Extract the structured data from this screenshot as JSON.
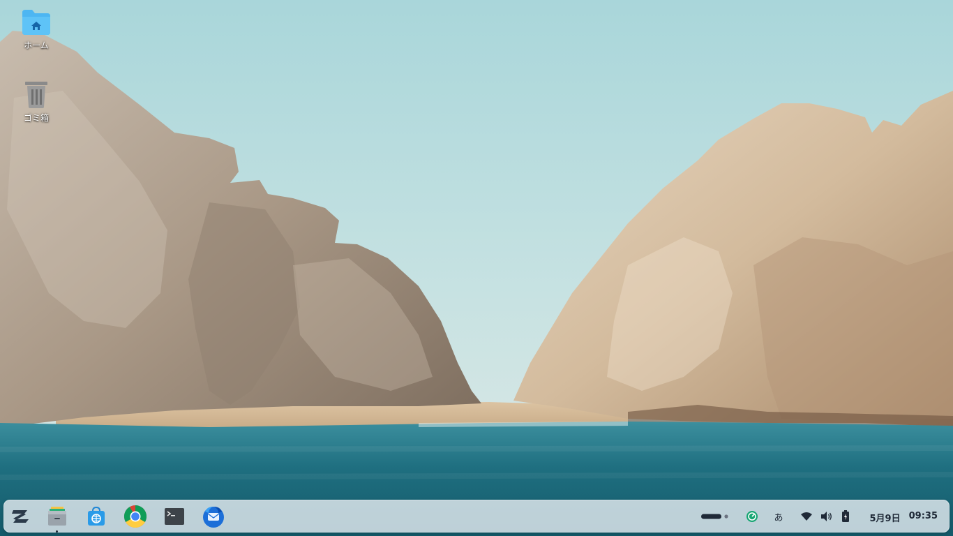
{
  "desktop": {
    "icons": [
      {
        "label": "ホーム",
        "icon": "home-folder-icon"
      },
      {
        "label": "ゴミ箱",
        "icon": "trash-icon"
      }
    ]
  },
  "taskbar": {
    "apps": [
      {
        "icon": "zorin-menu-icon"
      },
      {
        "icon": "files-icon",
        "running": true
      },
      {
        "icon": "software-store-icon"
      },
      {
        "icon": "chrome-icon"
      },
      {
        "icon": "terminal-icon"
      },
      {
        "icon": "thunderbird-icon"
      }
    ],
    "tray": {
      "ime": "あ",
      "icons": [
        "workspace-indicator-icon",
        "update-icon",
        "wifi-icon",
        "volume-icon",
        "battery-icon"
      ]
    },
    "clock": {
      "date": "5月9日",
      "time": "09:35"
    }
  },
  "colors": {
    "folder": "#4db6f2",
    "taskbar": "#e8eef2",
    "accent": "#2f8bdb"
  }
}
